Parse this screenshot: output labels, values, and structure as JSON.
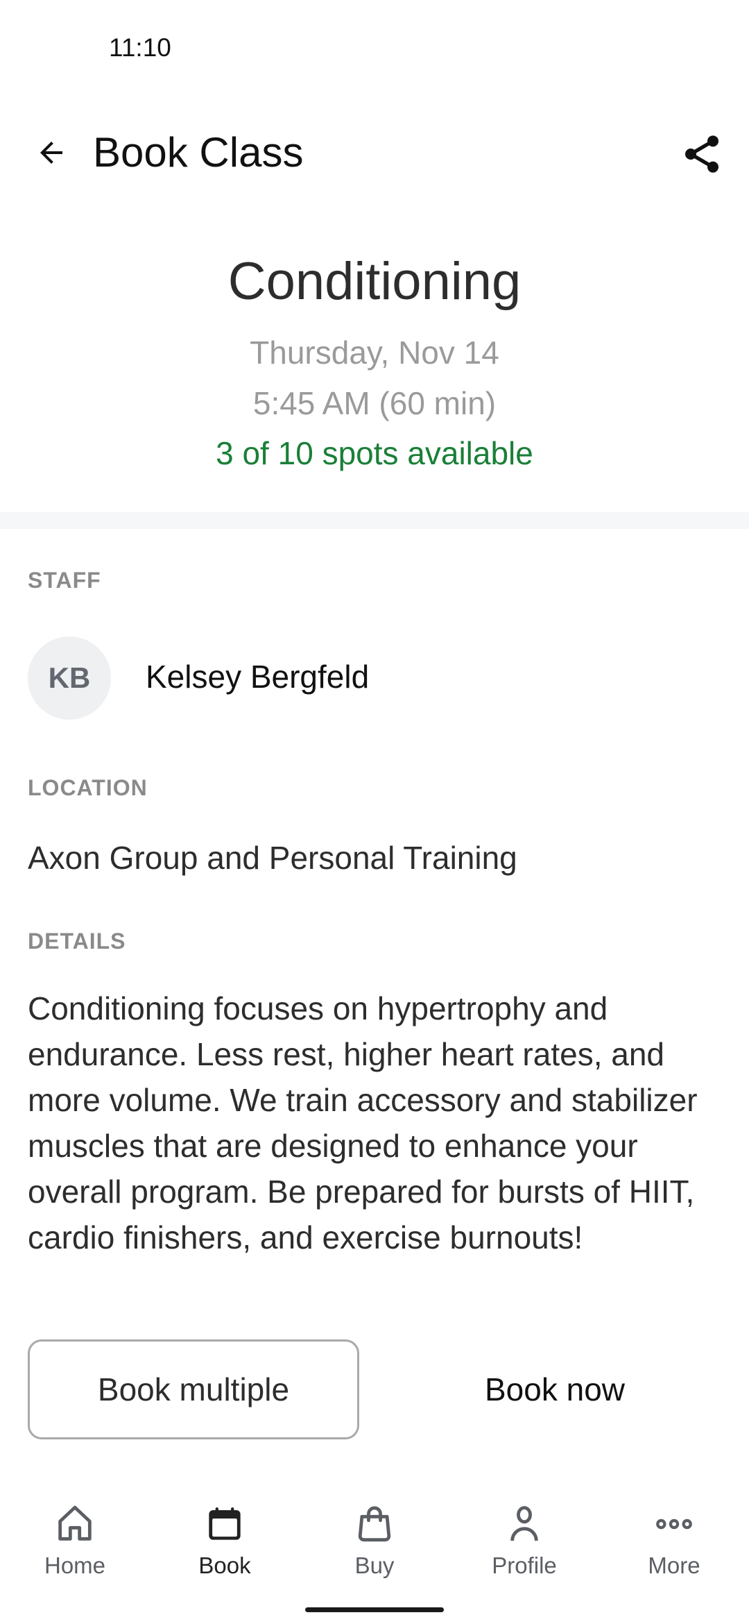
{
  "status_bar": {
    "time": "11:10"
  },
  "header": {
    "title": "Book Class",
    "back_icon": "arrow-left-icon",
    "share_icon": "share-icon"
  },
  "class_info": {
    "name": "Conditioning",
    "date": "Thursday, Nov 14",
    "time": "5:45 AM (60 min)",
    "availability": "3 of 10 spots available",
    "availability_color": "#1a7f37"
  },
  "staff": {
    "label": "STAFF",
    "initials": "KB",
    "name": "Kelsey Bergfeld"
  },
  "location": {
    "label": "LOCATION",
    "name": "Axon Group and Personal Training"
  },
  "details": {
    "label": "DETAILS",
    "text": "Conditioning focuses on hypertrophy and endurance. Less rest, higher heart rates, and more volume. We train accessory and stabilizer muscles that are designed to enhance your overall program. Be prepared for bursts of HIIT, cardio finishers, and exercise burnouts!"
  },
  "actions": {
    "book_multiple": "Book multiple",
    "book_now": "Book now"
  },
  "bottom_nav": {
    "active": "Book",
    "items": [
      {
        "label": "Home",
        "icon": "home-icon"
      },
      {
        "label": "Book",
        "icon": "calendar-icon"
      },
      {
        "label": "Buy",
        "icon": "shopping-bag-icon"
      },
      {
        "label": "Profile",
        "icon": "person-icon"
      },
      {
        "label": "More",
        "icon": "more-horizontal-icon"
      }
    ]
  }
}
